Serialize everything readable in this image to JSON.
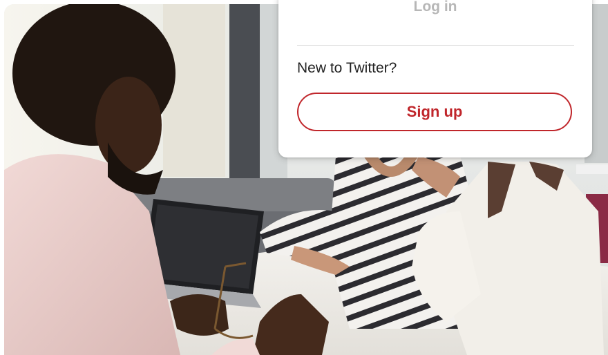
{
  "login_card": {
    "login_label": "Log in",
    "prompt_text": "New to Twitter?",
    "signup_label": "Sign up",
    "accent_color": "#c0262b",
    "login_text_color": "#b7b7b7"
  },
  "background_photo": {
    "subject": "office meeting photo"
  }
}
